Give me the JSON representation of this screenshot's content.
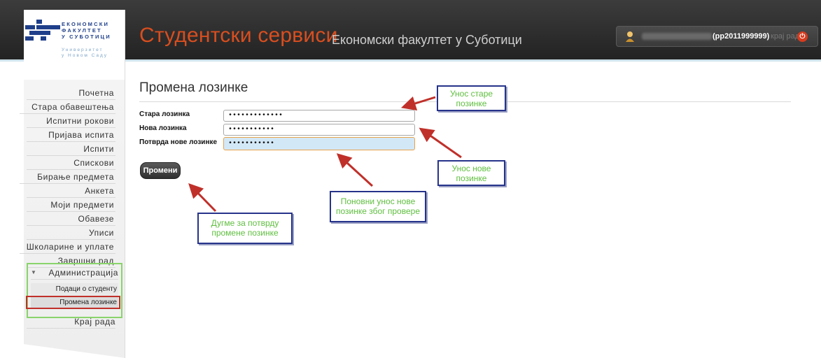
{
  "header": {
    "title": "Студентски сервиси",
    "subtitle": "Економски факултет у Суботици",
    "user_id": "(pp2011999999)",
    "logout_label": "крај рада",
    "power_icon": "power-icon"
  },
  "logo": {
    "lines": [
      "ЕКОНОМСКИ",
      "ФАКУЛТЕТ",
      "У СУБОТИЦИ"
    ],
    "university": [
      "Универзитет",
      "у Новом Саду"
    ]
  },
  "menu": {
    "items": [
      {
        "label": "Почетна"
      },
      {
        "label": "Стара обавештења"
      },
      {
        "label": "Испитни рокови"
      },
      {
        "label": "Пријава испита"
      },
      {
        "label": "Испити"
      },
      {
        "label": "Спискови"
      },
      {
        "label": "Бирање предмета"
      },
      {
        "label": "Анкета"
      },
      {
        "label": "Моји предмети"
      },
      {
        "label": "Обавезе"
      },
      {
        "label": "Уписи"
      },
      {
        "label": "Школарине и уплате"
      },
      {
        "label": "Завршни рад"
      }
    ],
    "admin": {
      "label": "Администрација",
      "sub": [
        {
          "label": "Подаци о студенту"
        },
        {
          "label": "Промена лозинке"
        }
      ]
    },
    "logout": "Крај рада"
  },
  "main": {
    "title": "Промена лозинке",
    "form": {
      "old_label": "Стара лозинка",
      "old_value": "•••••••••••••",
      "new_label": "Нова лозинка",
      "new_value": "•••••••••••",
      "confirm_label": "Потврда нове лозинке",
      "confirm_value": "•••••••••••",
      "submit": "Промени"
    }
  },
  "annotations": {
    "old": [
      "Унос старе",
      "позинке"
    ],
    "new": [
      "Унос нове",
      "позинке"
    ],
    "confirm": [
      "Поновни унос нове",
      "позинке због провере"
    ],
    "button": [
      "Дугме за потврду",
      "промене позинке"
    ]
  },
  "colors": {
    "accent": "#d84e1f",
    "callout_border": "#26338a",
    "callout_text": "#5fbf3f",
    "arrow": "#c0302a",
    "admin_box": "#8ad46b"
  }
}
